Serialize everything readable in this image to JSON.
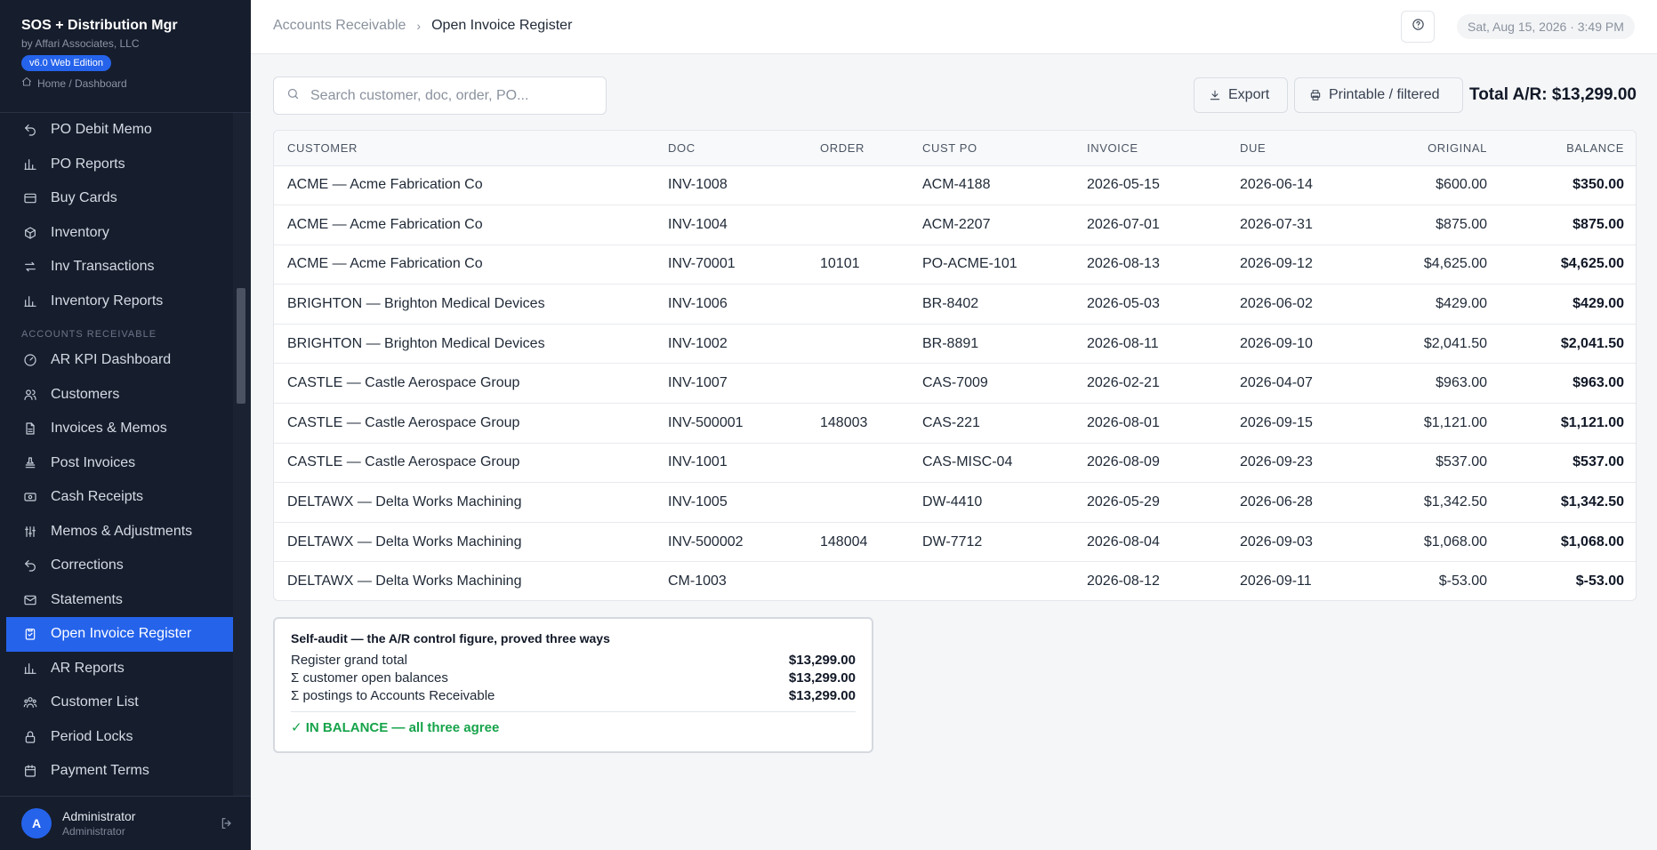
{
  "app": {
    "title": "SOS + Distribution Mgr",
    "subtitle": "by Affari Associates, LLC",
    "edition_badge": "v6.0 Web Edition",
    "home_link": "Home / Dashboard"
  },
  "sidebar": {
    "items_top": [
      {
        "label": "PO Debit Memo",
        "icon": "undo-arrow-icon"
      },
      {
        "label": "PO Reports",
        "icon": "bar-chart-icon"
      },
      {
        "label": "Buy Cards",
        "icon": "card-icon"
      },
      {
        "label": "Inventory",
        "icon": "box-icon"
      },
      {
        "label": "Inv Transactions",
        "icon": "swap-arrows-icon"
      },
      {
        "label": "Inventory Reports",
        "icon": "bar-chart-icon"
      }
    ],
    "section_label": "ACCOUNTS RECEIVABLE",
    "items_ar": [
      {
        "label": "AR KPI Dashboard",
        "icon": "gauge-icon"
      },
      {
        "label": "Customers",
        "icon": "users-icon"
      },
      {
        "label": "Invoices & Memos",
        "icon": "file-icon"
      },
      {
        "label": "Post Invoices",
        "icon": "stamp-icon"
      },
      {
        "label": "Cash Receipts",
        "icon": "banknote-icon"
      },
      {
        "label": "Memos & Adjustments",
        "icon": "sliders-icon"
      },
      {
        "label": "Corrections",
        "icon": "undo-arrow-icon"
      },
      {
        "label": "Statements",
        "icon": "mail-icon"
      },
      {
        "label": "Open Invoice Register",
        "icon": "clipboard-icon",
        "active": true
      },
      {
        "label": "AR Reports",
        "icon": "bar-chart-icon"
      },
      {
        "label": "Customer List",
        "icon": "users-group-icon"
      },
      {
        "label": "Period Locks",
        "icon": "lock-icon"
      },
      {
        "label": "Payment Terms",
        "icon": "calendar-icon"
      }
    ]
  },
  "user": {
    "initial": "A",
    "name": "Administrator",
    "role": "Administrator"
  },
  "header": {
    "breadcrumb_parent": "Accounts Receivable",
    "breadcrumb_current": "Open Invoice Register",
    "datetime": "Sat, Aug 15, 2026 · 3:49 PM"
  },
  "toolbar": {
    "search_placeholder": "Search customer, doc, order, PO...",
    "search_value": "",
    "export_label": "Export",
    "print_label": "Printable / filtered",
    "total_label": "Total A/R: $13,299.00"
  },
  "table": {
    "columns": [
      "CUSTOMER",
      "DOC",
      "ORDER",
      "CUST PO",
      "INVOICE",
      "DUE",
      "ORIGINAL",
      "BALANCE"
    ],
    "rows": [
      [
        "ACME — Acme Fabrication Co",
        "INV-1008",
        "",
        "ACM-4188",
        "2026-05-15",
        "2026-06-14",
        "$600.00",
        "$350.00"
      ],
      [
        "ACME — Acme Fabrication Co",
        "INV-1004",
        "",
        "ACM-2207",
        "2026-07-01",
        "2026-07-31",
        "$875.00",
        "$875.00"
      ],
      [
        "ACME — Acme Fabrication Co",
        "INV-70001",
        "10101",
        "PO-ACME-101",
        "2026-08-13",
        "2026-09-12",
        "$4,625.00",
        "$4,625.00"
      ],
      [
        "BRIGHTON — Brighton Medical Devices",
        "INV-1006",
        "",
        "BR-8402",
        "2026-05-03",
        "2026-06-02",
        "$429.00",
        "$429.00"
      ],
      [
        "BRIGHTON — Brighton Medical Devices",
        "INV-1002",
        "",
        "BR-8891",
        "2026-08-11",
        "2026-09-10",
        "$2,041.50",
        "$2,041.50"
      ],
      [
        "CASTLE — Castle Aerospace Group",
        "INV-1007",
        "",
        "CAS-7009",
        "2026-02-21",
        "2026-04-07",
        "$963.00",
        "$963.00"
      ],
      [
        "CASTLE — Castle Aerospace Group",
        "INV-500001",
        "148003",
        "CAS-221",
        "2026-08-01",
        "2026-09-15",
        "$1,121.00",
        "$1,121.00"
      ],
      [
        "CASTLE — Castle Aerospace Group",
        "INV-1001",
        "",
        "CAS-MISC-04",
        "2026-08-09",
        "2026-09-23",
        "$537.00",
        "$537.00"
      ],
      [
        "DELTAWX — Delta Works Machining",
        "INV-1005",
        "",
        "DW-4410",
        "2026-05-29",
        "2026-06-28",
        "$1,342.50",
        "$1,342.50"
      ],
      [
        "DELTAWX — Delta Works Machining",
        "INV-500002",
        "148004",
        "DW-7712",
        "2026-08-04",
        "2026-09-03",
        "$1,068.00",
        "$1,068.00"
      ],
      [
        "DELTAWX — Delta Works Machining",
        "CM-1003",
        "",
        "",
        "2026-08-12",
        "2026-09-11",
        "$-53.00",
        "$-53.00"
      ]
    ]
  },
  "audit": {
    "title": "Self-audit — the A/R control figure, proved three ways",
    "rows": [
      {
        "label": "Register grand total",
        "value": "$13,299.00"
      },
      {
        "label": "Σ customer open balances",
        "value": "$13,299.00"
      },
      {
        "label": "Σ postings to Accounts Receivable",
        "value": "$13,299.00"
      }
    ],
    "status": "✓ IN BALANCE — all three agree",
    "status_color": "#16a34a"
  },
  "colors": {
    "accent": "#2563eb",
    "sidebar_bg": "#161d2c"
  }
}
